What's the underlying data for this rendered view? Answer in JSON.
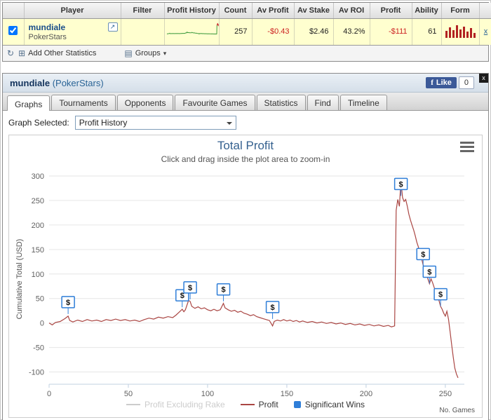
{
  "table": {
    "headers": [
      "Player",
      "Filter",
      "Profit History",
      "Count",
      "Av Profit",
      "Av Stake",
      "Av ROI",
      "Profit",
      "Ability",
      "Form"
    ],
    "row": {
      "checked": true,
      "player": "mundiale",
      "site": "PokerStars",
      "count": "257",
      "av_profit": "-$0.43",
      "av_stake": "$2.46",
      "av_roi": "43.2%",
      "profit": "-$111",
      "ability": "61",
      "remove_label": "x",
      "form_bars": [
        55,
        85,
        60,
        100,
        70,
        90,
        50,
        78,
        42
      ]
    },
    "footer": {
      "add_stats_label": "Add Other Statistics",
      "groups_label": "Groups"
    }
  },
  "panel": {
    "title_player": "mundiale",
    "title_site": "(PokerStars)",
    "like_label": "Like",
    "like_count": "0",
    "close_label": "x",
    "tabs": [
      {
        "label": "Graphs"
      },
      {
        "label": "Tournaments"
      },
      {
        "label": "Opponents"
      },
      {
        "label": "Favourite Games"
      },
      {
        "label": "Statistics"
      },
      {
        "label": "Find"
      },
      {
        "label": "Timeline"
      }
    ],
    "graph_selected_label": "Graph Selected:",
    "graph_selected_value": "Profit History"
  },
  "chart_data": {
    "type": "line",
    "title": "Total Profit",
    "subtitle": "Click and drag inside the plot area to zoom-in",
    "ylabel": "Cumulative Total (USD)",
    "xlabel": "No. Games",
    "xlim": [
      0,
      262
    ],
    "ylim": [
      -125,
      310
    ],
    "yticks": [
      -100,
      -50,
      0,
      50,
      100,
      150,
      200,
      250,
      300
    ],
    "xticks": [
      0,
      50,
      100,
      150,
      200,
      250
    ],
    "flag_symbol": "$",
    "legend_position": "bottom",
    "grid": true,
    "series": [
      {
        "name": "Profit Excluding Rake",
        "color": "#cccccc",
        "visible": false,
        "points": []
      },
      {
        "name": "Profit",
        "color": "#aa4643",
        "points": [
          [
            0,
            0
          ],
          [
            2,
            -4
          ],
          [
            4,
            1
          ],
          [
            7,
            3
          ],
          [
            10,
            9
          ],
          [
            12,
            14
          ],
          [
            13,
            5
          ],
          [
            15,
            2
          ],
          [
            18,
            6
          ],
          [
            21,
            3
          ],
          [
            24,
            7
          ],
          [
            27,
            4
          ],
          [
            30,
            6
          ],
          [
            33,
            3
          ],
          [
            36,
            7
          ],
          [
            39,
            5
          ],
          [
            42,
            8
          ],
          [
            45,
            5
          ],
          [
            48,
            7
          ],
          [
            51,
            4
          ],
          [
            54,
            6
          ],
          [
            57,
            3
          ],
          [
            60,
            7
          ],
          [
            63,
            10
          ],
          [
            66,
            8
          ],
          [
            69,
            12
          ],
          [
            72,
            10
          ],
          [
            75,
            13
          ],
          [
            78,
            11
          ],
          [
            80,
            16
          ],
          [
            82,
            22
          ],
          [
            84,
            28
          ],
          [
            85,
            23
          ],
          [
            86,
            27
          ],
          [
            88,
            46
          ],
          [
            89,
            44
          ],
          [
            90,
            34
          ],
          [
            92,
            30
          ],
          [
            94,
            33
          ],
          [
            96,
            29
          ],
          [
            98,
            31
          ],
          [
            100,
            27
          ],
          [
            102,
            25
          ],
          [
            104,
            28
          ],
          [
            106,
            25
          ],
          [
            108,
            27
          ],
          [
            110,
            40
          ],
          [
            111,
            31
          ],
          [
            113,
            27
          ],
          [
            115,
            24
          ],
          [
            117,
            26
          ],
          [
            119,
            22
          ],
          [
            121,
            24
          ],
          [
            123,
            20
          ],
          [
            125,
            18
          ],
          [
            127,
            15
          ],
          [
            129,
            17
          ],
          [
            131,
            13
          ],
          [
            133,
            11
          ],
          [
            135,
            9
          ],
          [
            137,
            7
          ],
          [
            139,
            5
          ],
          [
            141,
            -6
          ],
          [
            142,
            3
          ],
          [
            144,
            6
          ],
          [
            146,
            4
          ],
          [
            148,
            7
          ],
          [
            150,
            4
          ],
          [
            152,
            6
          ],
          [
            154,
            3
          ],
          [
            156,
            5
          ],
          [
            158,
            2
          ],
          [
            160,
            4
          ],
          [
            163,
            1
          ],
          [
            166,
            3
          ],
          [
            169,
            0
          ],
          [
            172,
            2
          ],
          [
            175,
            -1
          ],
          [
            178,
            1
          ],
          [
            181,
            -2
          ],
          [
            184,
            0
          ],
          [
            187,
            -3
          ],
          [
            190,
            -1
          ],
          [
            193,
            -4
          ],
          [
            196,
            -2
          ],
          [
            199,
            -5
          ],
          [
            202,
            -3
          ],
          [
            205,
            -6
          ],
          [
            208,
            -4
          ],
          [
            211,
            -7
          ],
          [
            214,
            -5
          ],
          [
            216,
            -8
          ],
          [
            218,
            -6
          ],
          [
            219,
            230
          ],
          [
            220,
            252
          ],
          [
            221,
            238
          ],
          [
            222,
            290
          ],
          [
            223,
            256
          ],
          [
            224,
            248
          ],
          [
            225,
            252
          ],
          [
            226,
            238
          ],
          [
            227,
            222
          ],
          [
            228,
            210
          ],
          [
            229,
            200
          ],
          [
            230,
            190
          ],
          [
            231,
            178
          ],
          [
            232,
            165
          ],
          [
            233,
            155
          ],
          [
            234,
            143
          ],
          [
            235,
            132
          ],
          [
            236,
            118
          ],
          [
            237,
            110
          ],
          [
            238,
            100
          ],
          [
            239,
            90
          ],
          [
            240,
            80
          ],
          [
            241,
            90
          ],
          [
            242,
            82
          ],
          [
            243,
            72
          ],
          [
            244,
            64
          ],
          [
            245,
            56
          ],
          [
            246,
            46
          ],
          [
            247,
            34
          ],
          [
            248,
            28
          ],
          [
            249,
            20
          ],
          [
            250,
            14
          ],
          [
            251,
            24
          ],
          [
            252,
            8
          ],
          [
            253,
            -18
          ],
          [
            254,
            -44
          ],
          [
            255,
            -70
          ],
          [
            256,
            -92
          ],
          [
            257,
            -104
          ],
          [
            258,
            -112
          ]
        ]
      },
      {
        "name": "Significant Wins",
        "color": "#2f7ed8",
        "type": "flags",
        "points": [
          [
            12,
            14
          ],
          [
            84,
            28
          ],
          [
            89,
            44
          ],
          [
            110,
            40
          ],
          [
            141,
            4
          ],
          [
            222,
            255
          ],
          [
            236,
            112
          ],
          [
            240,
            76
          ],
          [
            247,
            30
          ]
        ]
      }
    ]
  }
}
